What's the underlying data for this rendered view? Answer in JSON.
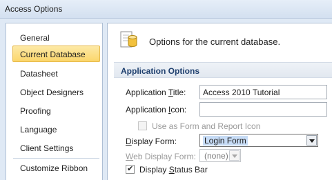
{
  "window": {
    "title": "Access Options"
  },
  "nav": {
    "items": [
      {
        "label": "General"
      },
      {
        "label": "Current Database"
      },
      {
        "label": "Datasheet"
      },
      {
        "label": "Object Designers"
      },
      {
        "label": "Proofing"
      },
      {
        "label": "Language"
      },
      {
        "label": "Client Settings"
      },
      {
        "label": "Customize Ribbon"
      }
    ],
    "selected": "Current Database"
  },
  "header": {
    "text": "Options for the current database.",
    "icon": "database-icon"
  },
  "section": {
    "title": "Application Options"
  },
  "fields": {
    "app_title": {
      "label_pre": "Application ",
      "label_u": "T",
      "label_post": "itle:",
      "value": "Access 2010 Tutorial"
    },
    "app_icon": {
      "label_pre": "Application ",
      "label_u": "I",
      "label_post": "con:",
      "value": ""
    },
    "use_as_form_icon": {
      "label": "Use as Form and Report Icon",
      "checked": false,
      "disabled": true
    },
    "display_form": {
      "label_pre": "",
      "label_u": "D",
      "label_post": "isplay Form:",
      "value": "Login Form"
    },
    "web_display_form": {
      "label_pre": "",
      "label_u": "W",
      "label_post": "eb Display Form:",
      "value": "(none)",
      "disabled": true
    },
    "display_status_bar": {
      "label_pre": "Display ",
      "label_u": "S",
      "label_post": "tatus Bar",
      "checked": true
    }
  },
  "colors": {
    "selected_nav": "#fbd66b",
    "section_title": "#1e3f6e",
    "combo_highlight": "#c7dcf6"
  }
}
